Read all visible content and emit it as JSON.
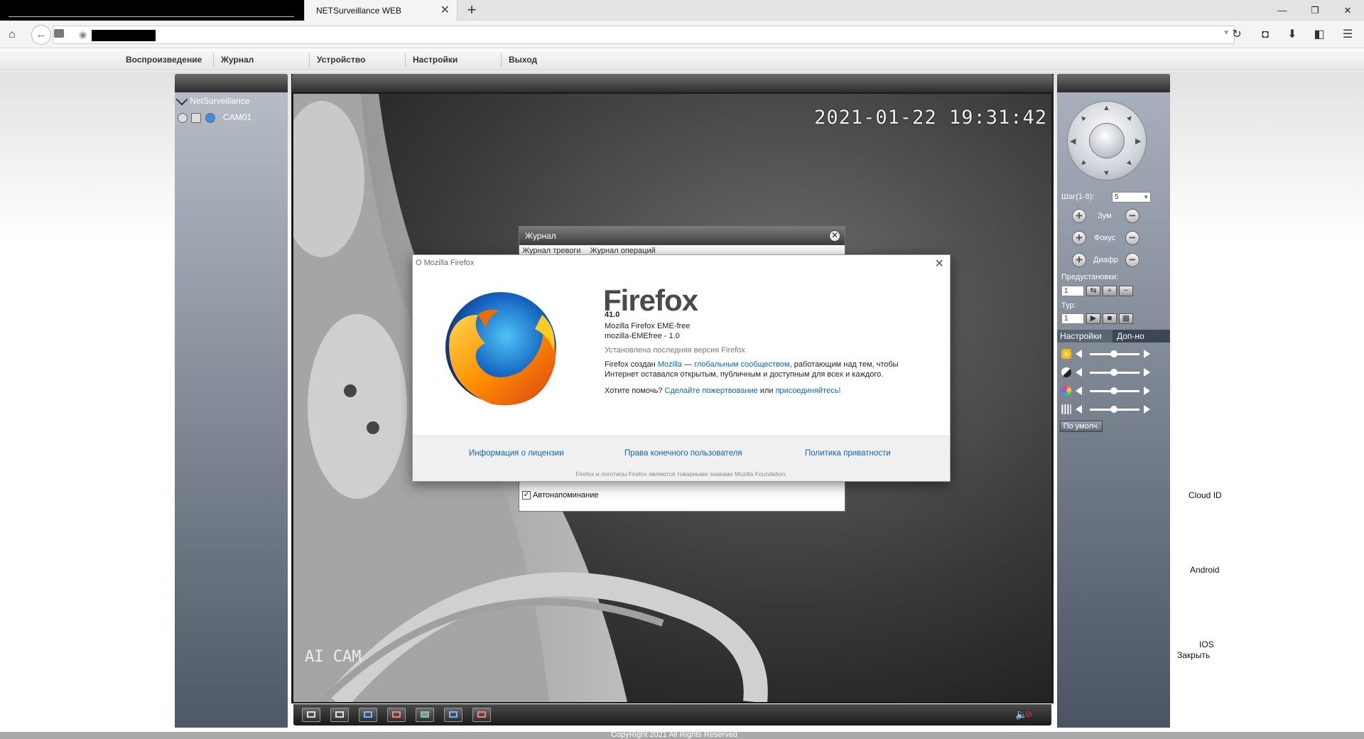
{
  "browser": {
    "active_tab_title": "NETSurveillance WEB",
    "new_tab_label": "+",
    "tab_close": "✕",
    "window_controls": {
      "minimize": "—",
      "maximize": "❐",
      "close": "✕"
    }
  },
  "app": {
    "menu": [
      "Воспроизведение",
      "Журнал",
      "Устройство",
      "Настройки",
      "Выход"
    ],
    "device_tree": {
      "root": "NetSurveillance",
      "camera": "CAM01"
    },
    "video": {
      "timestamp": "2021-01-22  19:31:42",
      "watermark": "AI CAM"
    },
    "ptz": {
      "step_label": "Шаг(1-8):",
      "step_value": "5",
      "zoom_label": "Зум",
      "focus_label": "Фокус",
      "iris_label": "Диафр",
      "presets_label": "Предустановки:",
      "preset_value": "1",
      "tour_label": "Тур:",
      "tour_value": "1"
    },
    "settings_tabs": [
      "Настройки",
      "Доп-но"
    ],
    "default_button": "По умолч.",
    "side_links": {
      "cloud": "Cloud ID",
      "android": "Android",
      "ios": "IOS",
      "close": "Закрыть"
    },
    "footer": "CopyRight 2021 All Rights Reserved"
  },
  "journal_dialog": {
    "title": "Журнал",
    "tabs": [
      "Журнал тревоги",
      "Журнал операций"
    ],
    "auto_reminder": "Автонапоминание"
  },
  "about_dialog": {
    "title": "О Mozilla Firefox",
    "product": "Firefox",
    "version": "41.0",
    "edition": "Mozilla Firefox EME-free",
    "distribution": "mozilla-EMEfree - 1.0",
    "status": "Установлена последняя версия Firefox",
    "created_prefix": "Firefox создан ",
    "mozilla_link": "Mozilla",
    "dash": " — ",
    "community_link": "глобальным сообществом",
    "created_suffix": ", работающим над тем, чтобы",
    "created_line2": "Интернет оставался открытым, публичным и доступным для всех и каждого.",
    "help_prefix": "Хотите помочь? ",
    "donate_link": "Сделайте пожертвование",
    "or": " или ",
    "join_link": "присоединяйтесь!",
    "footer_links": [
      "Информация о лицензии",
      "Права конечного пользователя",
      "Политика приватности"
    ],
    "trademark": "Firefox и логотипы Firefox являются товарными знаками Mozilla Foundation."
  },
  "colors": {
    "link": "#0a66b8",
    "panel_dark": "#4e5866"
  }
}
